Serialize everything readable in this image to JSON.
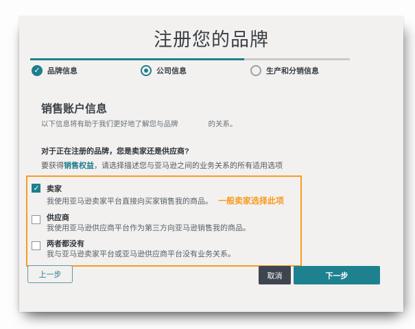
{
  "page": {
    "title": "注册您的品牌"
  },
  "stepper": {
    "progress_percent": 67,
    "steps": [
      {
        "label": "品牌信息",
        "state": "done",
        "icon": "check-circle-icon",
        "check_glyph": "✓"
      },
      {
        "label": "公司信息",
        "state": "active",
        "icon": "radio-selected-icon"
      },
      {
        "label": "生产和分销信息",
        "state": "pending",
        "icon": "radio-empty-icon"
      }
    ]
  },
  "section": {
    "heading": "销售账户信息",
    "subtext_prefix": "以下信息将有助于我们更好地了解您与品牌",
    "subtext_suffix": "的关系。"
  },
  "question": {
    "title": "对于正在注册的品牌，您是卖家还是供应商?",
    "instruction_prefix": "要获得",
    "instruction_link": "销售权益",
    "instruction_suffix": "，请选择描述您与亚马逊之间的业务关系的所有适用选项"
  },
  "options": [
    {
      "label": "卖家",
      "description": "我使用亚马逊卖家平台直接向买家销售我的商品。",
      "checked": true,
      "annotation": "一般卖家选择此项"
    },
    {
      "label": "供应商",
      "description": "我使用亚马逊供应商平台作为第三方向亚马逊销售我的商品。",
      "checked": false
    },
    {
      "label": "两者都没有",
      "description": "我与亚马逊卖家平台或亚马逊供应商平台没有业务关系。",
      "checked": false
    }
  ],
  "buttons": {
    "back": "上一步",
    "cancel": "取消",
    "next": "下一步"
  },
  "colors": {
    "teal": "#1e7e8c",
    "orange": "#f79b1e",
    "dark_button": "#3e454f",
    "card_bg": "#f2f1f0"
  }
}
